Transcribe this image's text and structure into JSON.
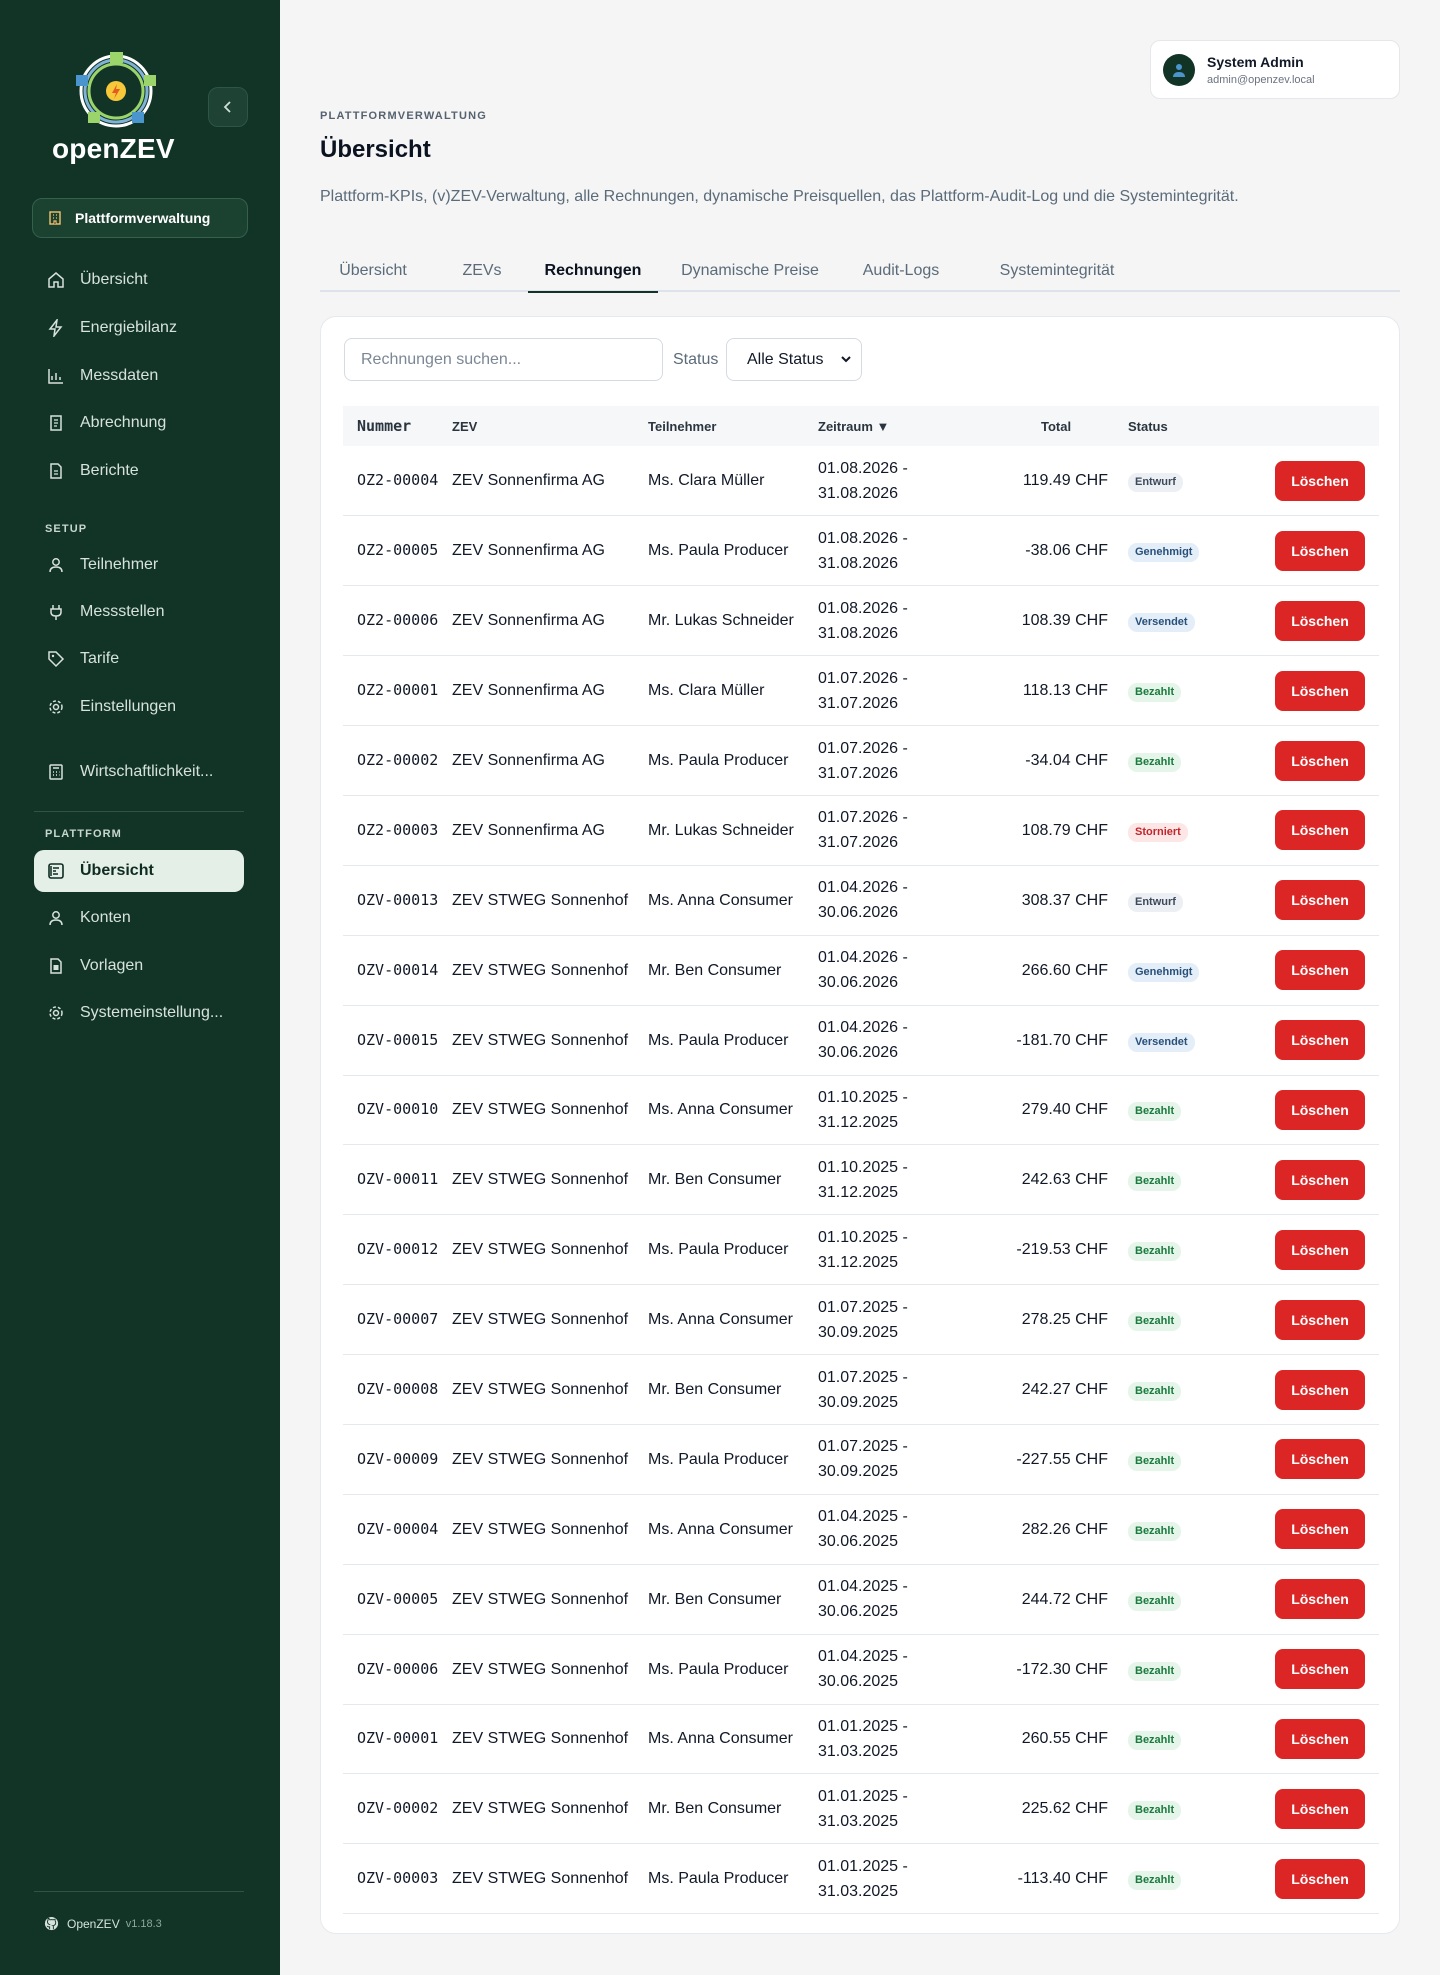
{
  "app": {
    "name": "openZEV",
    "version": "v1.18.3",
    "footer_label": "OpenZEV"
  },
  "sidebar": {
    "org_button": "Plattformverwaltung",
    "items_main": [
      {
        "label": "Übersicht",
        "icon": "home-icon"
      },
      {
        "label": "Energiebilanz",
        "icon": "bolt-icon"
      },
      {
        "label": "Messdaten",
        "icon": "bar-chart-icon"
      },
      {
        "label": "Abrechnung",
        "icon": "invoice-icon"
      },
      {
        "label": "Berichte",
        "icon": "report-icon"
      }
    ],
    "setup_title": "SETUP",
    "items_setup": [
      {
        "label": "Teilnehmer",
        "icon": "user-icon"
      },
      {
        "label": "Messstellen",
        "icon": "plug-icon"
      },
      {
        "label": "Tarife",
        "icon": "tag-icon"
      },
      {
        "label": "Einstellungen",
        "icon": "gear-icon"
      },
      {
        "label": "Wirtschaftlichkeit...",
        "icon": "calculator-icon"
      }
    ],
    "platform_title": "PLATTFORM",
    "items_platform": [
      {
        "label": "Übersicht",
        "icon": "dashboard-icon",
        "active": true
      },
      {
        "label": "Konten",
        "icon": "user-icon"
      },
      {
        "label": "Vorlagen",
        "icon": "template-icon"
      },
      {
        "label": "Systemeinstellung...",
        "icon": "gear-icon"
      }
    ]
  },
  "user": {
    "name": "System Admin",
    "email": "admin@openzev.local"
  },
  "header": {
    "eyebrow": "PLATTFORMVERWALTUNG",
    "title": "Übersicht",
    "subtitle": "Plattform-KPIs, (v)ZEV-Verwaltung, alle Rechnungen, dynamische Preisquellen, das Plattform-Audit-Log und die Systemintegrität."
  },
  "tabs": [
    "Übersicht",
    "ZEVs",
    "Rechnungen",
    "Dynamische Preise",
    "Audit-Logs",
    "Systemintegrität"
  ],
  "active_tab": "Rechnungen",
  "filters": {
    "search_placeholder": "Rechnungen suchen...",
    "status_label": "Status",
    "status_value": "Alle Status"
  },
  "table": {
    "columns": {
      "number": "Nummer",
      "zev": "ZEV",
      "participant": "Teilnehmer",
      "period": "Zeitraum ▼",
      "total": "Total",
      "status": "Status"
    },
    "delete_label": "Löschen",
    "rows": [
      {
        "number": "OZ2-00004",
        "zev": "ZEV Sonnenfirma AG",
        "participant": "Ms. Clara Müller",
        "period": "01.08.2026 - 31.08.2026",
        "total": "119.49 CHF",
        "status": "Entwurf"
      },
      {
        "number": "OZ2-00005",
        "zev": "ZEV Sonnenfirma AG",
        "participant": "Ms. Paula Producer",
        "period": "01.08.2026 - 31.08.2026",
        "total": "-38.06 CHF",
        "status": "Genehmigt"
      },
      {
        "number": "OZ2-00006",
        "zev": "ZEV Sonnenfirma AG",
        "participant": "Mr. Lukas Schneider",
        "period": "01.08.2026 - 31.08.2026",
        "total": "108.39 CHF",
        "status": "Versendet"
      },
      {
        "number": "OZ2-00001",
        "zev": "ZEV Sonnenfirma AG",
        "participant": "Ms. Clara Müller",
        "period": "01.07.2026 - 31.07.2026",
        "total": "118.13 CHF",
        "status": "Bezahlt"
      },
      {
        "number": "OZ2-00002",
        "zev": "ZEV Sonnenfirma AG",
        "participant": "Ms. Paula Producer",
        "period": "01.07.2026 - 31.07.2026",
        "total": "-34.04 CHF",
        "status": "Bezahlt"
      },
      {
        "number": "OZ2-00003",
        "zev": "ZEV Sonnenfirma AG",
        "participant": "Mr. Lukas Schneider",
        "period": "01.07.2026 - 31.07.2026",
        "total": "108.79 CHF",
        "status": "Storniert"
      },
      {
        "number": "OZV-00013",
        "zev": "ZEV STWEG Sonnenhof",
        "participant": "Ms. Anna Consumer",
        "period": "01.04.2026 - 30.06.2026",
        "total": "308.37 CHF",
        "status": "Entwurf"
      },
      {
        "number": "OZV-00014",
        "zev": "ZEV STWEG Sonnenhof",
        "participant": "Mr. Ben Consumer",
        "period": "01.04.2026 - 30.06.2026",
        "total": "266.60 CHF",
        "status": "Genehmigt"
      },
      {
        "number": "OZV-00015",
        "zev": "ZEV STWEG Sonnenhof",
        "participant": "Ms. Paula Producer",
        "period": "01.04.2026 - 30.06.2026",
        "total": "-181.70 CHF",
        "status": "Versendet"
      },
      {
        "number": "OZV-00010",
        "zev": "ZEV STWEG Sonnenhof",
        "participant": "Ms. Anna Consumer",
        "period": "01.10.2025 - 31.12.2025",
        "total": "279.40 CHF",
        "status": "Bezahlt"
      },
      {
        "number": "OZV-00011",
        "zev": "ZEV STWEG Sonnenhof",
        "participant": "Mr. Ben Consumer",
        "period": "01.10.2025 - 31.12.2025",
        "total": "242.63 CHF",
        "status": "Bezahlt"
      },
      {
        "number": "OZV-00012",
        "zev": "ZEV STWEG Sonnenhof",
        "participant": "Ms. Paula Producer",
        "period": "01.10.2025 - 31.12.2025",
        "total": "-219.53 CHF",
        "status": "Bezahlt"
      },
      {
        "number": "OZV-00007",
        "zev": "ZEV STWEG Sonnenhof",
        "participant": "Ms. Anna Consumer",
        "period": "01.07.2025 - 30.09.2025",
        "total": "278.25 CHF",
        "status": "Bezahlt"
      },
      {
        "number": "OZV-00008",
        "zev": "ZEV STWEG Sonnenhof",
        "participant": "Mr. Ben Consumer",
        "period": "01.07.2025 - 30.09.2025",
        "total": "242.27 CHF",
        "status": "Bezahlt"
      },
      {
        "number": "OZV-00009",
        "zev": "ZEV STWEG Sonnenhof",
        "participant": "Ms. Paula Producer",
        "period": "01.07.2025 - 30.09.2025",
        "total": "-227.55 CHF",
        "status": "Bezahlt"
      },
      {
        "number": "OZV-00004",
        "zev": "ZEV STWEG Sonnenhof",
        "participant": "Ms. Anna Consumer",
        "period": "01.04.2025 - 30.06.2025",
        "total": "282.26 CHF",
        "status": "Bezahlt"
      },
      {
        "number": "OZV-00005",
        "zev": "ZEV STWEG Sonnenhof",
        "participant": "Mr. Ben Consumer",
        "period": "01.04.2025 - 30.06.2025",
        "total": "244.72 CHF",
        "status": "Bezahlt"
      },
      {
        "number": "OZV-00006",
        "zev": "ZEV STWEG Sonnenhof",
        "participant": "Ms. Paula Producer",
        "period": "01.04.2025 - 30.06.2025",
        "total": "-172.30 CHF",
        "status": "Bezahlt"
      },
      {
        "number": "OZV-00001",
        "zev": "ZEV STWEG Sonnenhof",
        "participant": "Ms. Anna Consumer",
        "period": "01.01.2025 - 31.03.2025",
        "total": "260.55 CHF",
        "status": "Bezahlt"
      },
      {
        "number": "OZV-00002",
        "zev": "ZEV STWEG Sonnenhof",
        "participant": "Mr. Ben Consumer",
        "period": "01.01.2025 - 31.03.2025",
        "total": "225.62 CHF",
        "status": "Bezahlt"
      },
      {
        "number": "OZV-00003",
        "zev": "ZEV STWEG Sonnenhof",
        "participant": "Ms. Paula Producer",
        "period": "01.01.2025 - 31.03.2025",
        "total": "-113.40 CHF",
        "status": "Bezahlt"
      }
    ]
  },
  "colors": {
    "sidebar_bg": "#113427",
    "accent": "#113427",
    "danger": "#dc2626"
  }
}
